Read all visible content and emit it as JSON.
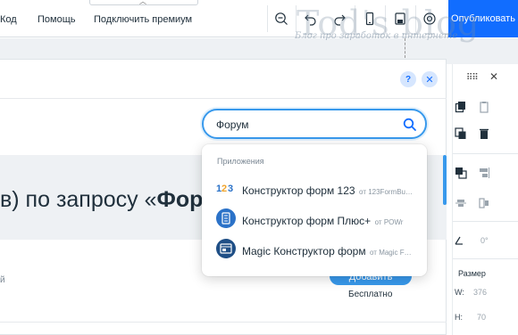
{
  "topbar": {
    "menu": [
      "Код",
      "Помощь",
      "Подключить премиум"
    ],
    "publish_label": "Опубликовать",
    "icons": [
      "zoom-out-icon",
      "undo-icon",
      "redo-icon",
      "mobile-view-icon",
      "save-icon",
      "preview-icon"
    ]
  },
  "watermark": {
    "title": "Tod's blog",
    "subtitle": "Блог про заработок в интернете"
  },
  "market": {
    "search": {
      "value": "Форум",
      "placeholder": ""
    },
    "result_prefix": "в) по запросу «",
    "result_query": "Фору",
    "row_left_text": "й",
    "add_label": "Добавить",
    "price_label": "Бесплатно",
    "help_label": "?",
    "close_label": "✕"
  },
  "dropdown": {
    "section_label": "Приложения",
    "items": [
      {
        "name": "Конструктор форм 123",
        "by": "от 123FormBu…",
        "icon": "form-123-icon"
      },
      {
        "name": "Конструктор форм Плюс+",
        "by": "от POWr",
        "icon": "form-plus-icon"
      },
      {
        "name": "Magic Конструктор форм",
        "by": "от Magic F…",
        "icon": "magic-form-icon"
      }
    ]
  },
  "right_panel": {
    "angle_value": "0°",
    "size_label": "Размер",
    "width_key": "W:",
    "width_value": "376",
    "height_key": "H:",
    "height_value": "70"
  },
  "colors": {
    "accent": "#116dff",
    "search_border": "#3899ec",
    "banner_bg": "#eef1f4"
  }
}
